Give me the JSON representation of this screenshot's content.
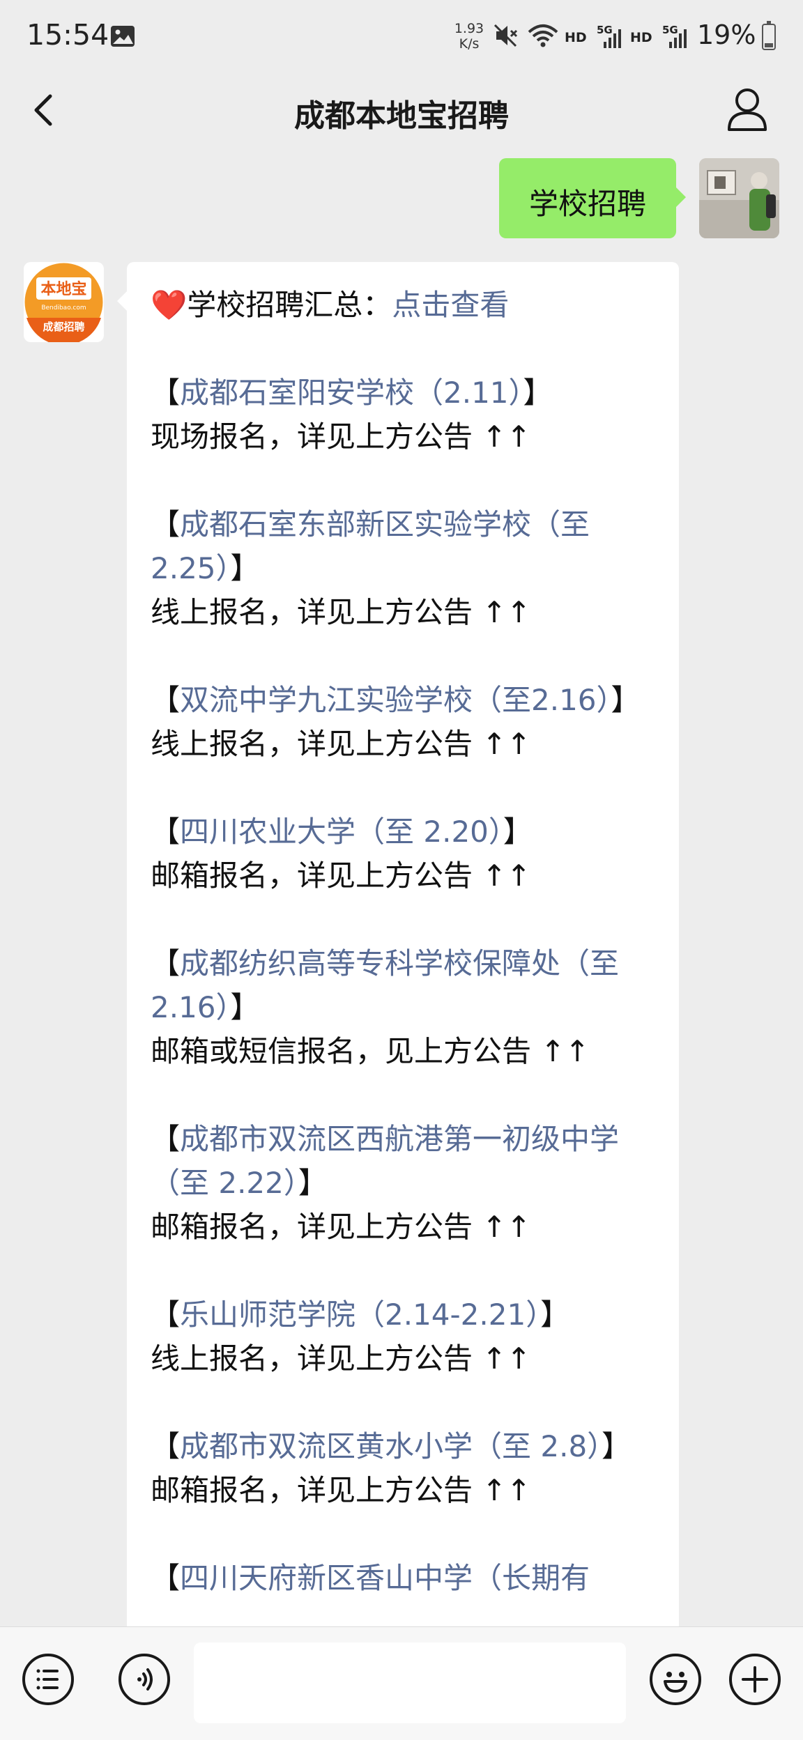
{
  "status_bar": {
    "time": "15:54",
    "net_speed_value": "1.93",
    "net_speed_unit": "K/s",
    "hd_label": "HD",
    "network_label": "5G",
    "battery": "19%",
    "icons": [
      "gallery-icon",
      "mute-icon",
      "wifi-icon",
      "signal-icon",
      "battery-icon"
    ]
  },
  "nav": {
    "title": "成都本地宝招聘",
    "back_icon": "chevron-left-icon",
    "profile_icon": "person-icon"
  },
  "chat": {
    "sent_message": "学校招聘",
    "bot_avatar": {
      "logo_top": "本地宝",
      "logo_url_text": "Bendibao.com",
      "logo_bottom": "成都招聘"
    },
    "summary": {
      "heart": "❤️",
      "label": "学校招聘汇总：",
      "link": "点击查看"
    },
    "items": [
      {
        "open": "【",
        "title": "成都石室阳安学校（2.11）",
        "close": "】",
        "note": "现场报名，详见上方公告 ↑↑"
      },
      {
        "open": "【",
        "title": "成都石室东部新区实验学校（至2.25）",
        "close": "】",
        "note": "线上报名，详见上方公告 ↑↑"
      },
      {
        "open": "【",
        "title": "双流中学九江实验学校（至2.16）",
        "close": "】",
        "note": "线上报名，详见上方公告 ↑↑"
      },
      {
        "open": "【",
        "title": "四川农业大学（至 2.20）",
        "close": "】",
        "note": "邮箱报名，详见上方公告 ↑↑"
      },
      {
        "open": "【",
        "title": "成都纺织高等专科学校保障处（至2.16）",
        "close": "】",
        "note": "邮箱或短信报名，见上方公告 ↑↑"
      },
      {
        "open": "【",
        "title": "成都市双流区西航港第一初级中学（至 2.22）",
        "close": "】",
        "note": "邮箱报名，详见上方公告 ↑↑"
      },
      {
        "open": "【",
        "title": "乐山师范学院（2.14-2.21）",
        "close": "】",
        "note": "线上报名，详见上方公告 ↑↑"
      },
      {
        "open": "【",
        "title": "成都市双流区黄水小学（至 2.8）",
        "close": "】",
        "note": "邮箱报名，详见上方公告 ↑↑"
      },
      {
        "open": "【",
        "title": "四川天府新区香山中学（长期有",
        "close": "",
        "note": ""
      }
    ]
  },
  "input_bar": {
    "icons": [
      "menu-list-icon",
      "voice-icon",
      "emoji-icon",
      "plus-icon"
    ]
  }
}
